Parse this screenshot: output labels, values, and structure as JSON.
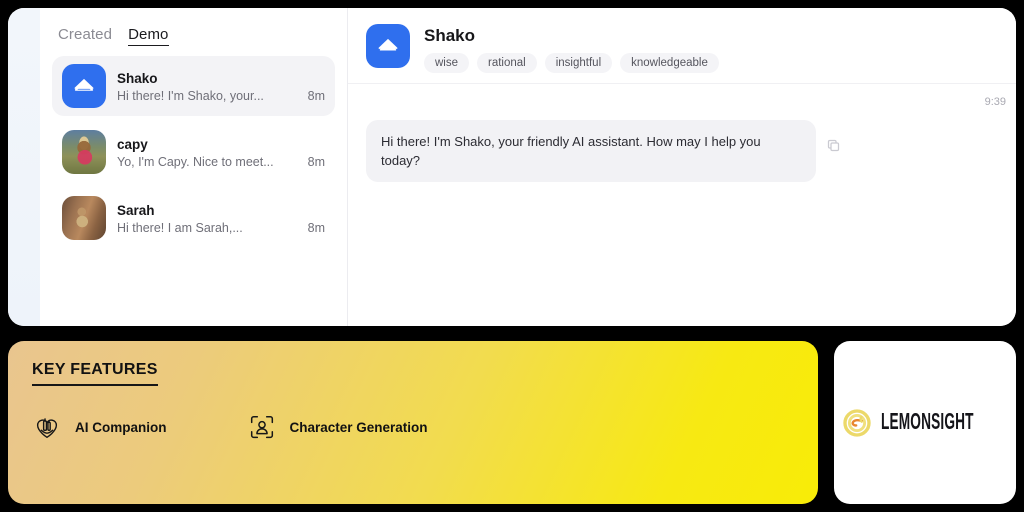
{
  "app": {
    "sidebar": {
      "tabs": [
        {
          "label": "Created",
          "active": false
        },
        {
          "label": "Demo",
          "active": true
        }
      ],
      "conversations": [
        {
          "name": "Shako",
          "snippet": "Hi there! I'm Shako, your...",
          "time": "8m",
          "avatar": "brand-chevron-icon",
          "selected": true
        },
        {
          "name": "capy",
          "snippet": "Yo, I'm Capy. Nice to meet...",
          "time": "8m",
          "avatar": "capybara-photo",
          "selected": false
        },
        {
          "name": "Sarah",
          "snippet": "Hi there! I am Sarah,...",
          "time": "8m",
          "avatar": "sarah-photo",
          "selected": false
        }
      ]
    },
    "chat": {
      "title": "Shako",
      "avatar_icon": "brand-chevron-icon",
      "tags": [
        "wise",
        "rational",
        "insightful",
        "knowledgeable"
      ],
      "timestamp": "9:39",
      "messages": [
        {
          "author": "Shako",
          "text": "Hi there! I'm Shako, your friendly AI assistant. How may I help you today?",
          "copy_icon": "copy-icon"
        }
      ]
    }
  },
  "features": {
    "title": "KEY FEATURES",
    "items": [
      {
        "label": "AI Companion",
        "icon": "heart-robot-icon"
      },
      {
        "label": "Character Generation",
        "icon": "person-scan-icon"
      }
    ]
  },
  "brand": {
    "name": "LEMONSIGHT",
    "mark_icon": "lemon-swirl-icon"
  },
  "colors": {
    "accent_blue": "#2f6fee",
    "banner_yellow": "#f8ec07",
    "banner_tan": "#e9c58f",
    "text_dark": "#17171a",
    "text_muted": "#6f6f78"
  }
}
